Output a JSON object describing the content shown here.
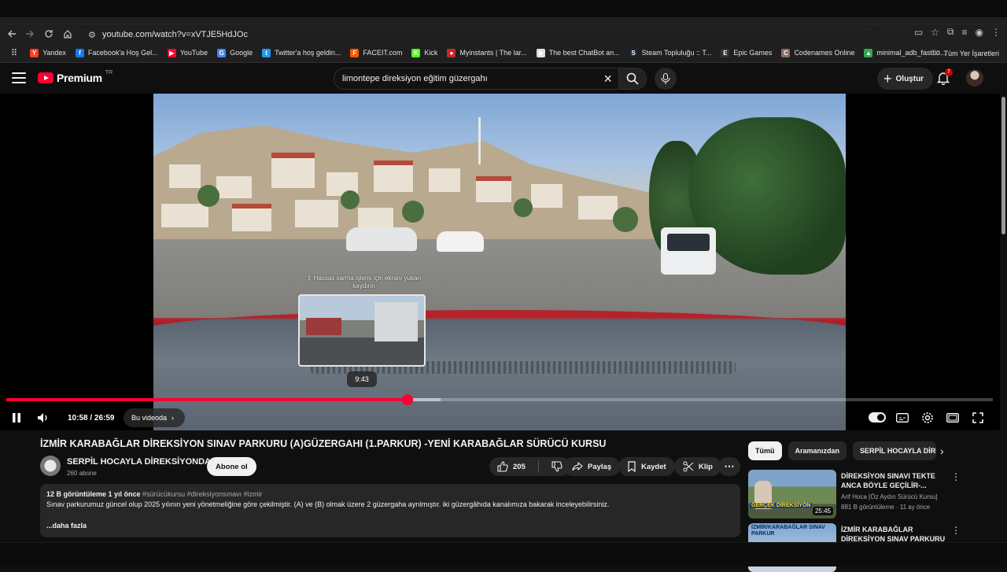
{
  "browser": {
    "url": "youtube.com/watch?v=xVTJE5HdJOc",
    "bookmarks": [
      {
        "label": "Yandex",
        "color": "#fc3f1d",
        "glyph": "Y"
      },
      {
        "label": "Facebook'a Hoş Gel...",
        "color": "#1877f2",
        "glyph": "f"
      },
      {
        "label": "YouTube",
        "color": "#ff0033",
        "glyph": "▶"
      },
      {
        "label": "Google",
        "color": "#4285f4",
        "glyph": "G"
      },
      {
        "label": "Twitter'a hoş geldin...",
        "color": "#1d9bf0",
        "glyph": "t"
      },
      {
        "label": "FACEIT.com",
        "color": "#ff5500",
        "glyph": "F"
      },
      {
        "label": "Kick",
        "color": "#53fc18",
        "glyph": "K"
      },
      {
        "label": "Myinstants | The lar...",
        "color": "#c62828",
        "glyph": "●"
      },
      {
        "label": "The best ChatBot an...",
        "color": "#e0e0e0",
        "glyph": "◆"
      },
      {
        "label": "Steam Topluluğu :: T...",
        "color": "#1b2838",
        "glyph": "S"
      },
      {
        "label": "Epic Games",
        "color": "#333333",
        "glyph": "E"
      },
      {
        "label": "Codenames Online",
        "color": "#8d6e63",
        "glyph": "C"
      },
      {
        "label": "minimal_adb_fastbo...",
        "color": "#34a853",
        "glyph": "▲"
      }
    ],
    "all_bookmarks_label": "Tüm Yer İşaretleri"
  },
  "yt": {
    "brand": "Premium",
    "brand_sup": "TR",
    "search_query": "limontepe direksiyon eğitim güzergahı",
    "create_label": "Oluştur",
    "notification_count": "7"
  },
  "player": {
    "seek_hint": "⇪ Hassas sarma işlemi için ekranı yukarı kaydırın",
    "hover_time": "9:43",
    "time_label": "10:58 / 26:59",
    "chapter_label": "Bu videoda",
    "progress": {
      "played": 0.407,
      "buffered": 0.44,
      "hover": 0.36
    }
  },
  "video": {
    "title": "İZMİR KARABAĞLAR DİREKSİYON SINAV PARKURU (A)GÜZERGAHI (1.PARKUR) -YENİ KARABAĞLAR SÜRÜCÜ KURSU",
    "channel": "SERPİL HOCAYLA DİREKSİYONDA",
    "subscribers": "260 abone",
    "subscribe_label": "Abone ol",
    "likes": "205",
    "share_label": "Paylaş",
    "save_label": "Kaydet",
    "clip_label": "Klip",
    "views_date": "12 B görüntüleme  1 yıl önce",
    "hashtags": "#sürücükursu #direksiyonsınavı #izmir",
    "description": "Sınav parkurumuz  güncel olup 2025 yılının yeni yönetmeliğine göre çekilmiştir. (A) ve (B) olmak üzere 2 güzergaha ayrılmıştır. iki güzergâhıda kanalımıza bakarak inceleyebilirsiniz.",
    "more_label": "...daha fazla"
  },
  "sidebar": {
    "chips": [
      "Tümü",
      "Aramanızdan",
      "SERPİL HOCAYLA DİREK"
    ],
    "recs": [
      {
        "title": "DİREKSİYON SINAVI TEKTE ANCA BÖYLE GEÇİLİR-...",
        "channel": "Arif Hoca [Öz Aydın Sürücü Kursu]",
        "meta": "881 B görüntüleme · 11 ay önce",
        "duration": "25:45",
        "thumb_text": "GERÇEK DİREKSİYON"
      },
      {
        "title": "İZMİR KARABAĞLAR DİREKSİYON SINAV PARKURU ...",
        "thumb_text": "İZMİR/KARABAĞLAR SINAV PARKUR"
      }
    ]
  }
}
